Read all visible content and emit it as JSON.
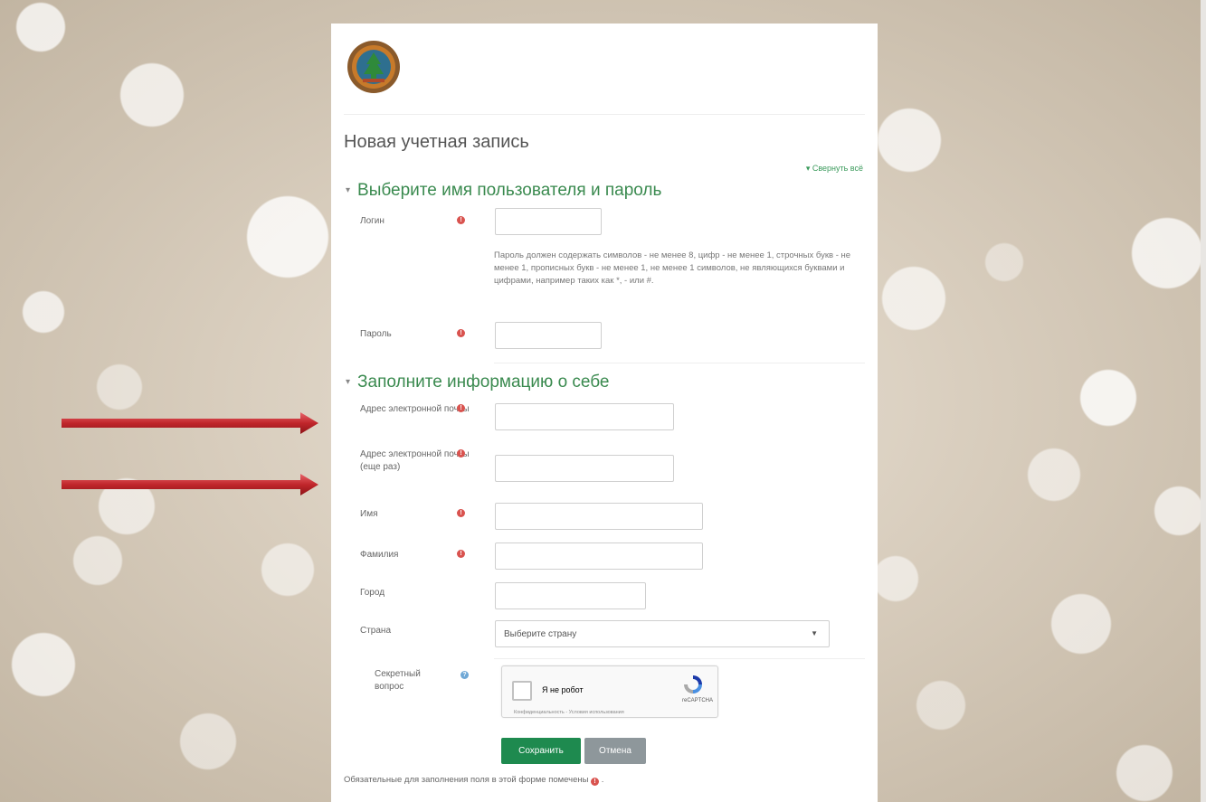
{
  "logo": {
    "alt": "logo"
  },
  "page": {
    "title": "Новая учетная запись",
    "collapse_all": "▾ Свернуть всё"
  },
  "sections": {
    "credentials": {
      "title": "Выберите имя пользователя и пароль",
      "login_label": "Логин",
      "password_hint": "Пароль должен содержать символов - не менее 8, цифр - не менее 1, строчных букв - не менее 1, прописных букв - не менее 1, не менее 1 символов, не являющихся буквами и цифрами, например таких как *, - или #.",
      "password_label": "Пароль"
    },
    "about": {
      "title": "Заполните информацию о себе",
      "email_label": "Адрес электронной почты",
      "email2_label": "Адрес электронной почты (еще раз)",
      "firstname_label": "Имя",
      "lastname_label": "Фамилия",
      "city_label": "Город",
      "country_label": "Страна",
      "country_selected": "Выберите страну",
      "secret_label": "Секретный вопрос"
    }
  },
  "recaptcha": {
    "checkbox_label": "Я не робот",
    "brand": "reCAPTCHA",
    "links": "Конфиденциальность - Условия использования"
  },
  "buttons": {
    "save": "Сохранить",
    "cancel": "Отмена"
  },
  "footer": {
    "required_note": "Обязательные для заполнения поля в этой форме помечены",
    "required_note_end": "."
  },
  "icons": {
    "required": "exclamation-icon",
    "help": "question-icon"
  },
  "colors": {
    "accent": "#3a8a4f",
    "save_button": "#1e8a4f",
    "cancel_button": "#8e979b",
    "required": "#d9534f",
    "arrow": "#c0262b"
  }
}
